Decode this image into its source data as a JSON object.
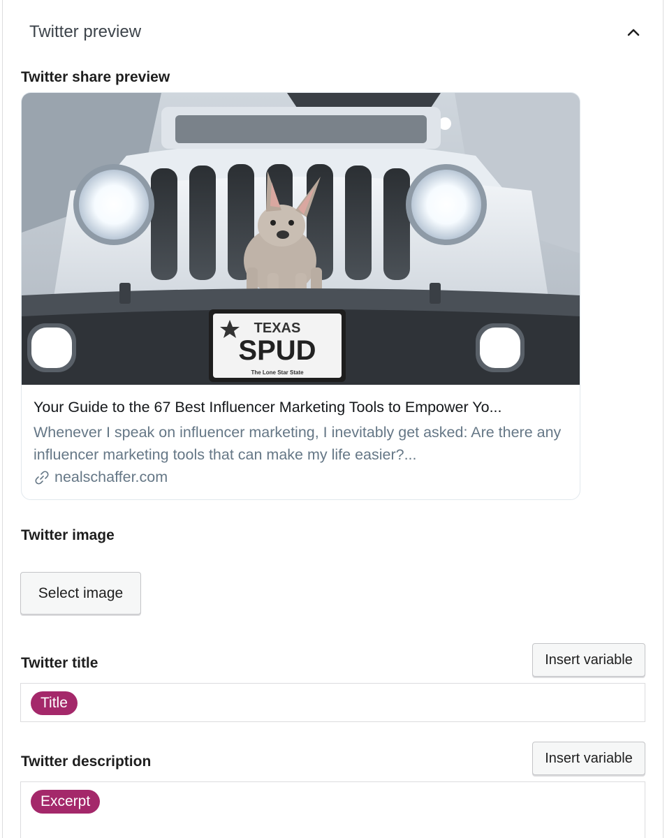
{
  "panel": {
    "title": "Twitter preview",
    "toggle_icon": "chevron-up-icon"
  },
  "share_preview": {
    "label": "Twitter share preview",
    "card": {
      "image_plate_state": "TEXAS",
      "image_plate_text": "SPUD",
      "image_plate_footer": "The Lone Star State",
      "title": "Your Guide to the 67 Best Influencer Marketing Tools to Empower Yo...",
      "description": "Whenever I speak on influencer marketing, I inevitably get asked: Are there any influencer marketing tools that can make my life easier?...",
      "domain": "nealschaffer.com",
      "domain_icon": "link-icon"
    }
  },
  "image_field": {
    "label": "Twitter image",
    "button_label": "Select image"
  },
  "title_field": {
    "label": "Twitter title",
    "insert_label": "Insert variable",
    "token": "Title"
  },
  "description_field": {
    "label": "Twitter description",
    "insert_label": "Insert variable",
    "token": "Excerpt"
  },
  "colors": {
    "token_bg": "#a4286a",
    "link_gray": "#657786"
  }
}
